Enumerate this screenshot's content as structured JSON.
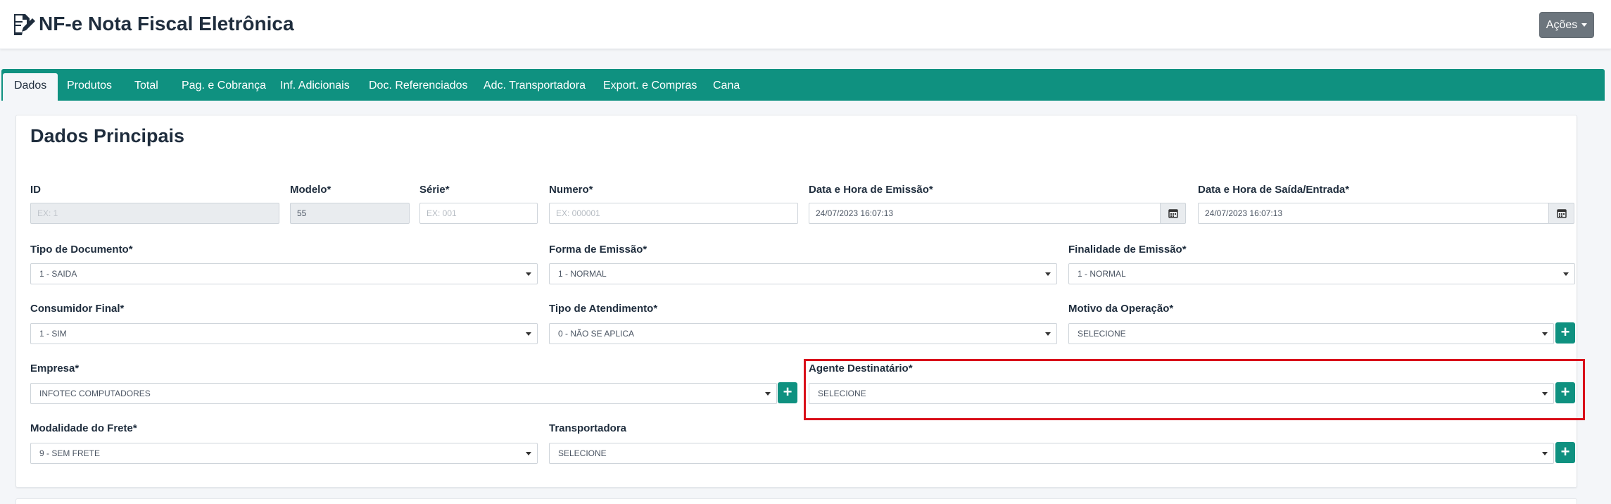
{
  "header": {
    "title": "NF-e Nota Fiscal Eletrônica",
    "actions_label": "Ações"
  },
  "tabs": [
    {
      "label": "Dados",
      "active": true
    },
    {
      "label": "Produtos"
    },
    {
      "label": "Total"
    },
    {
      "label": "Pag. e Cobrança"
    },
    {
      "label": "Inf. Adicionais"
    },
    {
      "label": "Doc. Referenciados"
    },
    {
      "label": "Adc. Transportadora"
    },
    {
      "label": "Export. e Compras"
    },
    {
      "label": "Cana"
    }
  ],
  "section": {
    "title": "Dados Principais"
  },
  "fields": {
    "id": {
      "label": "ID",
      "placeholder": "EX: 1"
    },
    "modelo": {
      "label": "Modelo*",
      "value": "55"
    },
    "serie": {
      "label": "Série*",
      "placeholder": "EX: 001"
    },
    "numero": {
      "label": "Numero*",
      "placeholder": "EX: 000001"
    },
    "data_emissao": {
      "label": "Data e Hora de Emissão*",
      "value": "24/07/2023 16:07:13"
    },
    "data_saida": {
      "label": "Data e Hora de Saída/Entrada*",
      "value": "24/07/2023 16:07:13"
    },
    "tipo_documento": {
      "label": "Tipo de Documento*",
      "value": "1 - SAIDA"
    },
    "forma_emissao": {
      "label": "Forma de Emissão*",
      "value": "1 - NORMAL"
    },
    "finalidade_emissao": {
      "label": "Finalidade de Emissão*",
      "value": "1 - NORMAL"
    },
    "consumidor_final": {
      "label": "Consumidor Final*",
      "value": "1 - SIM"
    },
    "tipo_atendimento": {
      "label": "Tipo de Atendimento*",
      "value": "0 - NÃO SE APLICA"
    },
    "motivo_operacao": {
      "label": "Motivo da Operação*",
      "value": "SELECIONE"
    },
    "empresa": {
      "label": "Empresa*",
      "value": "INFOTEC COMPUTADORES"
    },
    "agente_destinatario": {
      "label": "Agente Destinatário*",
      "value": "SELECIONE"
    },
    "modalidade_frete": {
      "label": "Modalidade do Frete*",
      "value": "9 - SEM FRETE"
    },
    "transportadora": {
      "label": "Transportadora",
      "value": "SELECIONE"
    }
  },
  "icons": {
    "page": "edit-document-icon",
    "calendar": "calendar-icon",
    "add": "plus-icon"
  },
  "colors": {
    "accent": "#0f9180",
    "highlight": "#d9101a",
    "actions_button": "#6c757d"
  }
}
